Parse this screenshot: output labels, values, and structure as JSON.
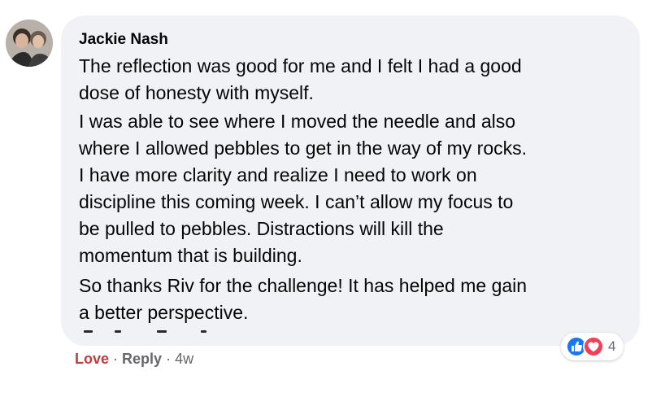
{
  "comment": {
    "author": "Jackie Nash",
    "paragraphs": [
      [
        "The reflection was good for me and I felt I had a good",
        "dose of honesty with myself."
      ],
      [
        "I was able to see where I moved the needle and also",
        "where I allowed pebbles to get in the way of my rocks.",
        "I have more clarity and realize I need to work on",
        "discipline this coming week. I can’t allow my focus to",
        "be pulled to pebbles. Distractions will kill the",
        "momentum that is building."
      ],
      [
        "So thanks Riv for the challenge! It has helped me gain",
        "a better perspective."
      ]
    ]
  },
  "actions": {
    "love_label": "Love",
    "separator": "·",
    "reply_label": "Reply",
    "time": "4w"
  },
  "reactions": {
    "icons": [
      "like-icon",
      "heart-icon"
    ],
    "count": "4",
    "colors": {
      "like": "#1877f2",
      "heart": "#f33e58",
      "love_text": "#c33b3b"
    }
  }
}
